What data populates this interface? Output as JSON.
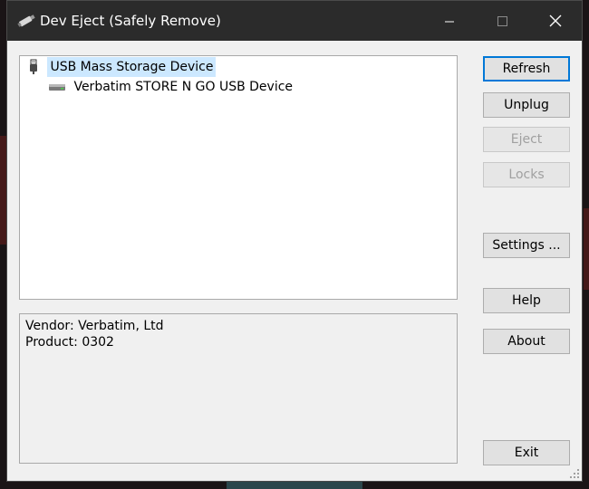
{
  "window": {
    "title": "Dev Eject (Safely Remove)"
  },
  "tree": {
    "items": [
      {
        "label": "USB Mass Storage Device",
        "icon": "usb-plug-icon",
        "selected": true
      },
      {
        "label": "Verbatim STORE N GO USB Device",
        "icon": "drive-icon",
        "selected": false
      }
    ]
  },
  "info": {
    "lines": [
      "Vendor: Verbatim, Ltd",
      "Product: 0302"
    ]
  },
  "buttons": {
    "refresh": "Refresh",
    "unplug": "Unplug",
    "eject": "Eject",
    "locks": "Locks",
    "settings": "Settings ...",
    "help": "Help",
    "about": "About",
    "exit": "Exit"
  },
  "colors": {
    "titlebar": "#2b2b2b",
    "selection": "#cce8ff",
    "default_button_border": "#0078d7"
  }
}
